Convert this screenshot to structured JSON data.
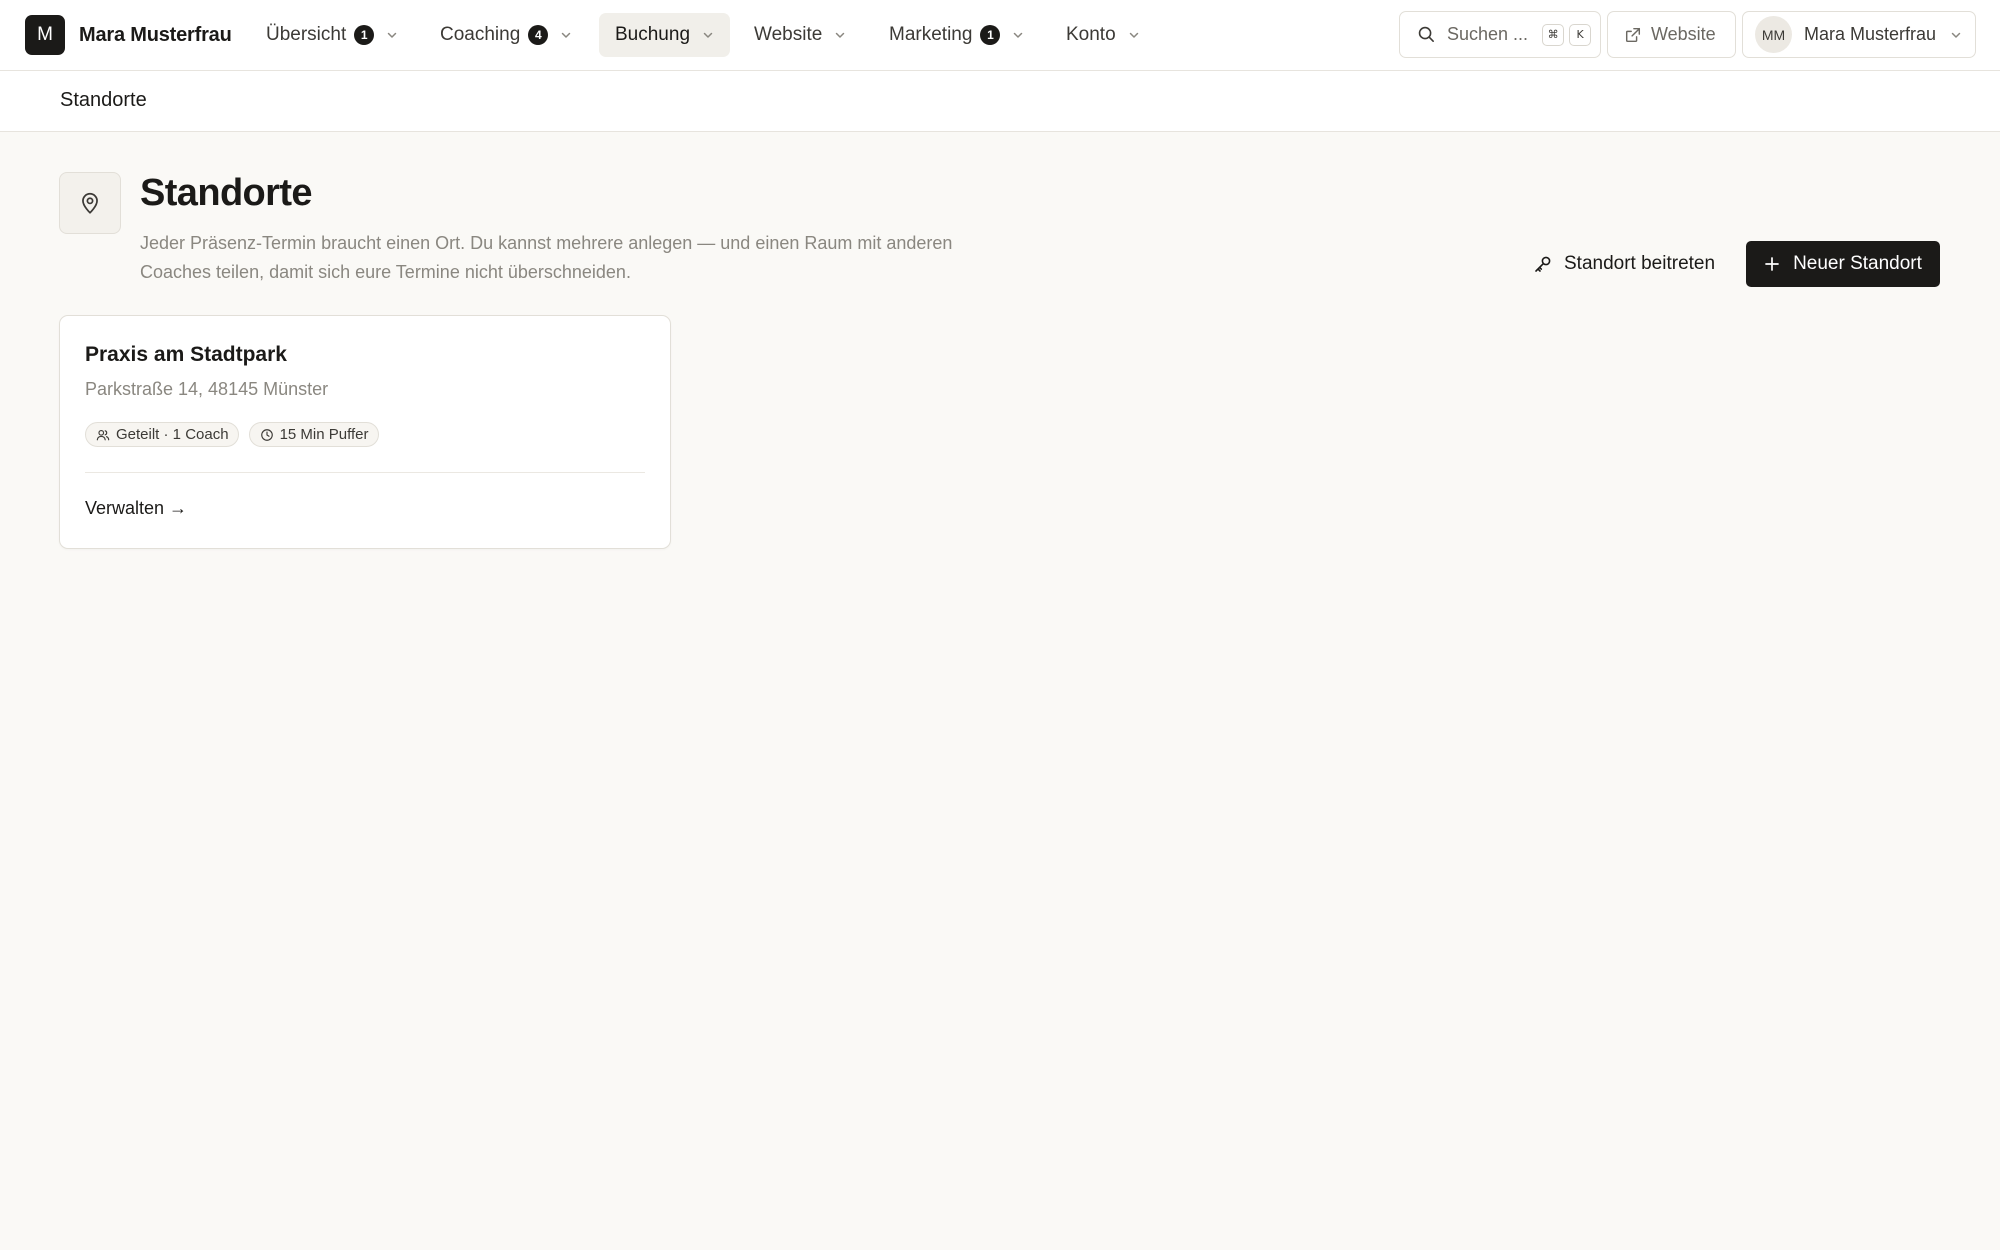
{
  "brand": {
    "logo_letter": "M",
    "name": "Mara Musterfrau"
  },
  "nav": {
    "items": [
      {
        "label": "Übersicht",
        "badge": "1"
      },
      {
        "label": "Coaching",
        "badge": "4"
      },
      {
        "label": "Buchung",
        "badge": null,
        "active": true
      },
      {
        "label": "Website",
        "badge": null
      },
      {
        "label": "Marketing",
        "badge": "1"
      },
      {
        "label": "Konto",
        "badge": null
      }
    ]
  },
  "search": {
    "placeholder": "Suchen ...",
    "shortcut_keys": [
      "⌘",
      "K"
    ]
  },
  "website_button": {
    "label": "Website"
  },
  "user": {
    "initials": "MM",
    "name": "Mara Musterfrau"
  },
  "breadcrumb": {
    "title": "Standorte"
  },
  "page": {
    "title": "Standorte",
    "description_line1": "Jeder Präsenz-Termin braucht einen Ort. Du kannst mehrere anlegen — und einen Raum mit anderen",
    "description_line2": "Coaches teilen, damit sich eure Termine nicht überschneiden.",
    "join_label": "Standort beitreten",
    "new_label": "Neuer Standort"
  },
  "locations": [
    {
      "name": "Praxis am Stadtpark",
      "address": "Parkstraße 14, 48145 Münster",
      "shared_label": "Geteilt · 1 Coach",
      "buffer_label": "15 Min Puffer",
      "manage_label": "Verwalten →"
    }
  ],
  "colors": {
    "accent": "#1b1a18",
    "background": "#faf9f6",
    "muted_text": "#8a8780"
  },
  "icons": {
    "page": "map-pin-icon",
    "join": "key-icon",
    "new": "plus-icon",
    "search": "search-icon",
    "website": "external-link-icon",
    "shared": "users-icon",
    "buffer": "clock-icon"
  }
}
